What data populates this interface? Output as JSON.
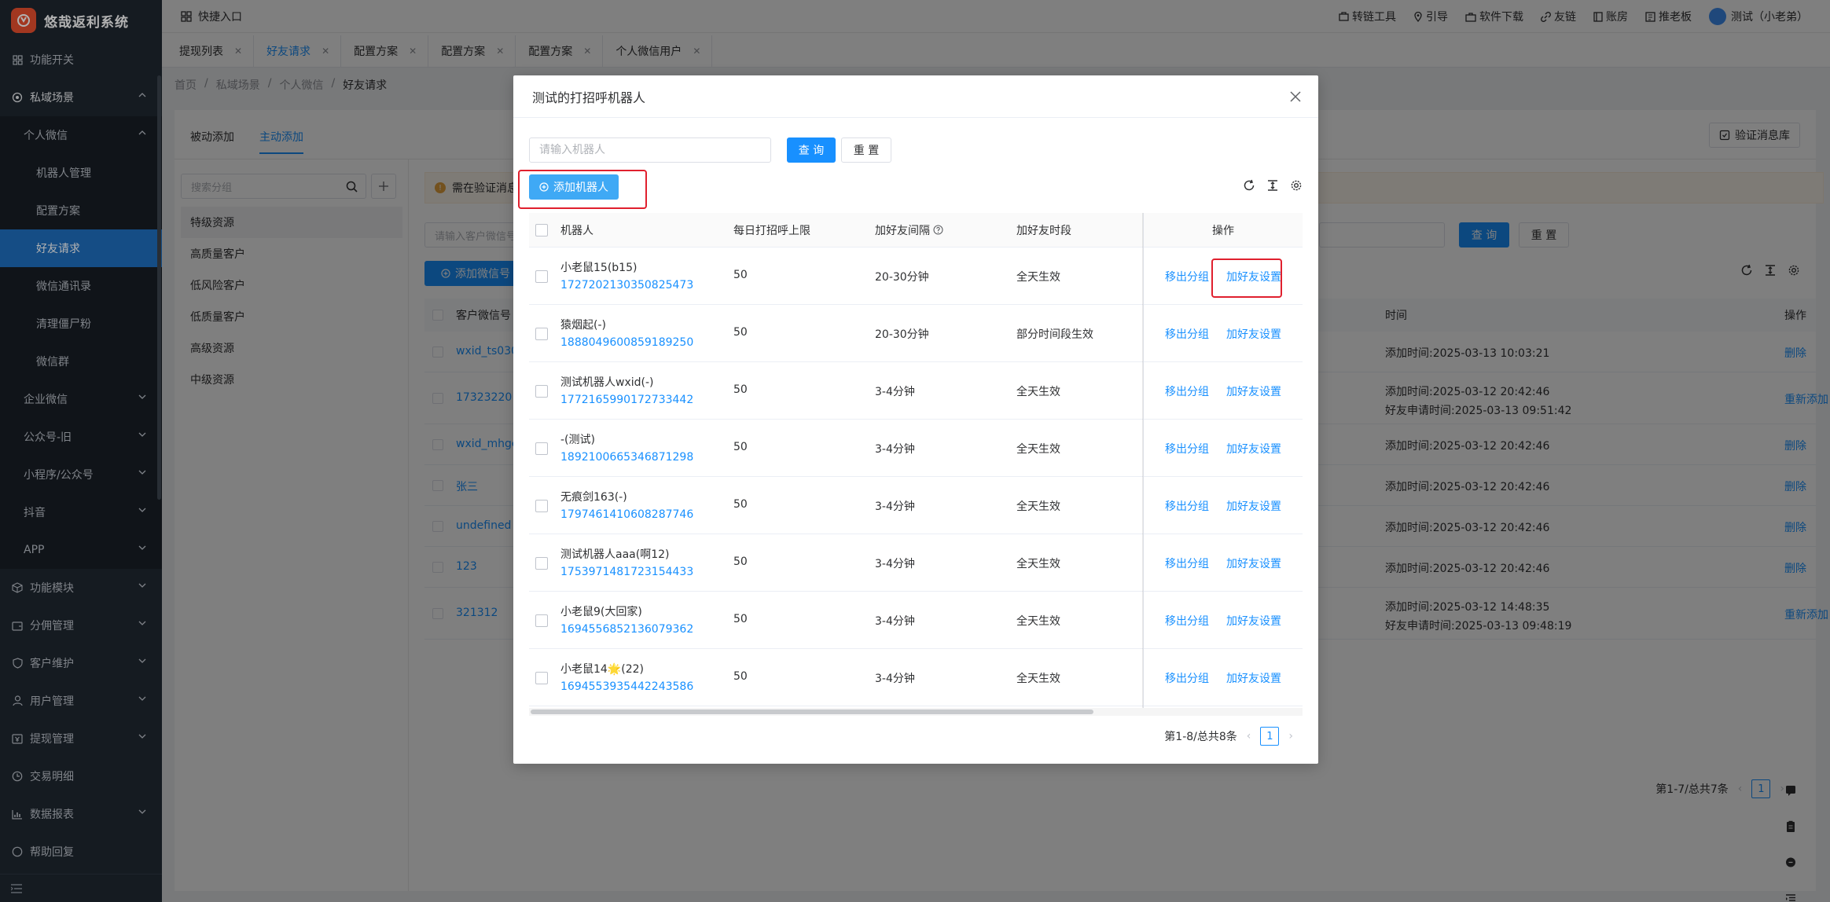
{
  "app": {
    "name": "悠哉返利系统"
  },
  "sidebar": {
    "items": [
      {
        "label": "功能开关",
        "icon": "grid-icon",
        "level": 0,
        "chevron": ""
      },
      {
        "label": "私域场景",
        "icon": "target-icon",
        "level": 0,
        "chevron": "up"
      },
      {
        "label": "个人微信",
        "icon": "",
        "level": 1,
        "chevron": "up"
      },
      {
        "label": "机器人管理",
        "icon": "",
        "level": 2,
        "chevron": ""
      },
      {
        "label": "配置方案",
        "icon": "",
        "level": 2,
        "chevron": ""
      },
      {
        "label": "好友请求",
        "icon": "",
        "level": 2,
        "chevron": "",
        "active": true
      },
      {
        "label": "微信通讯录",
        "icon": "",
        "level": 2,
        "chevron": ""
      },
      {
        "label": "清理僵尸粉",
        "icon": "",
        "level": 2,
        "chevron": ""
      },
      {
        "label": "微信群",
        "icon": "",
        "level": 2,
        "chevron": ""
      },
      {
        "label": "企业微信",
        "icon": "",
        "level": 1,
        "chevron": "down"
      },
      {
        "label": "公众号-旧",
        "icon": "",
        "level": 1,
        "chevron": "down"
      },
      {
        "label": "小程序/公众号",
        "icon": "",
        "level": 1,
        "chevron": "down"
      },
      {
        "label": "抖音",
        "icon": "",
        "level": 1,
        "chevron": "down"
      },
      {
        "label": "APP",
        "icon": "",
        "level": 1,
        "chevron": "down"
      },
      {
        "label": "功能模块",
        "icon": "cube-icon",
        "level": 0,
        "chevron": "down"
      },
      {
        "label": "分佣管理",
        "icon": "wallet-icon",
        "level": 0,
        "chevron": "down"
      },
      {
        "label": "客户维护",
        "icon": "shield-icon",
        "level": 0,
        "chevron": "down"
      },
      {
        "label": "用户管理",
        "icon": "user-icon",
        "level": 0,
        "chevron": "down"
      },
      {
        "label": "提现管理",
        "icon": "cash-icon",
        "level": 0,
        "chevron": "down"
      },
      {
        "label": "交易明细",
        "icon": "clock-icon",
        "level": 0,
        "chevron": ""
      },
      {
        "label": "数据报表",
        "icon": "chart-icon",
        "level": 0,
        "chevron": "down"
      },
      {
        "label": "帮助回复",
        "icon": "help-icon",
        "level": 0,
        "chevron": ""
      }
    ]
  },
  "topbar": {
    "quick_entry": "快捷入口",
    "links": [
      "转链工具",
      "引导",
      "软件下载",
      "友链",
      "账房",
      "推老板"
    ],
    "user": "测试（小老弟）"
  },
  "tabs": [
    {
      "label": "提现列表",
      "active": false
    },
    {
      "label": "好友请求",
      "active": true
    },
    {
      "label": "配置方案",
      "active": false
    },
    {
      "label": "配置方案",
      "active": false
    },
    {
      "label": "配置方案",
      "active": false
    },
    {
      "label": "个人微信用户",
      "active": false
    }
  ],
  "breadcrumb": [
    "首页",
    "私域场景",
    "个人微信",
    "好友请求"
  ],
  "page": {
    "subtabs": [
      "被动添加",
      "主动添加"
    ],
    "verify_lib": "验证消息库",
    "group_search_placeholder": "搜索分组",
    "groups": [
      "特级资源",
      "高质量客户",
      "低风险客户",
      "低质量客户",
      "高级资源",
      "中级资源"
    ],
    "notice": "需在验证消息",
    "customer_search_placeholder": "请输入客户微信号",
    "query": "查 询",
    "reset": "重 置",
    "add_wx": "添加微信号",
    "headers": [
      "客户微信号",
      "时间",
      "操作"
    ],
    "rows": [
      {
        "wx": "wxid_ts030",
        "time1": "添加时间:2025-03-13 10:03:21",
        "time2": "",
        "ops": [
          "删除"
        ]
      },
      {
        "wx": "17323220",
        "time1": "添加时间:2025-03-12 20:42:46",
        "time2": "好友申请时间:2025-03-13 09:51:42",
        "ops": [
          "重新添加",
          "删除"
        ]
      },
      {
        "wx": "wxid_mhgc",
        "time1": "添加时间:2025-03-12 20:42:46",
        "time2": "",
        "ops": [
          "删除"
        ]
      },
      {
        "wx": "张三",
        "time1": "添加时间:2025-03-12 20:42:46",
        "time2": "",
        "ops": [
          "删除"
        ]
      },
      {
        "wx": "undefined",
        "time1": "添加时间:2025-03-12 20:42:46",
        "time2": "",
        "ops": [
          "删除"
        ]
      },
      {
        "wx": "123",
        "time1": "添加时间:2025-03-12 20:42:46",
        "time2": "",
        "ops": [
          "删除"
        ]
      },
      {
        "wx": "321312",
        "time1": "添加时间:2025-03-12 14:48:35",
        "time2": "好友申请时间:2025-03-13 09:48:19",
        "ops": [
          "重新添加",
          "删除"
        ]
      }
    ],
    "pager_text": "第1-7/总共7条",
    "pager_page": "1"
  },
  "modal": {
    "title": "测试的打招呼机器人",
    "search_placeholder": "请输入机器人",
    "query": "查 询",
    "reset": "重 置",
    "add_robot": "添加机器人",
    "headers": {
      "name": "机器人",
      "limit": "每日打招呼上限",
      "interval": "加好友间隔",
      "segment": "加好友时段",
      "ops": "操作"
    },
    "op_move": "移出分组",
    "op_setting": "加好友设置",
    "rows": [
      {
        "name": "小老鼠15(b15)",
        "id": "1727202130350825473",
        "limit": "50",
        "interval": "20-30分钟",
        "segment": "全天生效"
      },
      {
        "name": "猿烟起(-)",
        "id": "1888049600859189250",
        "limit": "50",
        "interval": "20-30分钟",
        "segment": "部分时间段生效"
      },
      {
        "name": "测试机器人wxid(-)",
        "id": "1772165990172733442",
        "limit": "50",
        "interval": "3-4分钟",
        "segment": "全天生效"
      },
      {
        "name": "-(测试)",
        "id": "1892100665346871298",
        "limit": "50",
        "interval": "3-4分钟",
        "segment": "全天生效"
      },
      {
        "name": "无痕剑163(-)",
        "id": "1797461410608287746",
        "limit": "50",
        "interval": "3-4分钟",
        "segment": "全天生效"
      },
      {
        "name": "测试机器人aaa(啊12)",
        "id": "1753971481723154433",
        "limit": "50",
        "interval": "3-4分钟",
        "segment": "全天生效"
      },
      {
        "name": "小老鼠9(大回家)",
        "id": "1694556852136079362",
        "limit": "50",
        "interval": "3-4分钟",
        "segment": "全天生效"
      },
      {
        "name": "小老鼠14🌟(22)",
        "id": "1694553935442243586",
        "limit": "50",
        "interval": "3-4分钟",
        "segment": "全天生效"
      }
    ],
    "pager_text": "第1-8/总共8条",
    "pager_page": "1"
  },
  "colors": {
    "primary": "#1890ff",
    "highlight": "#e0202e",
    "sidebar": "#1f2730",
    "active_menu": "#1f6fbf"
  }
}
